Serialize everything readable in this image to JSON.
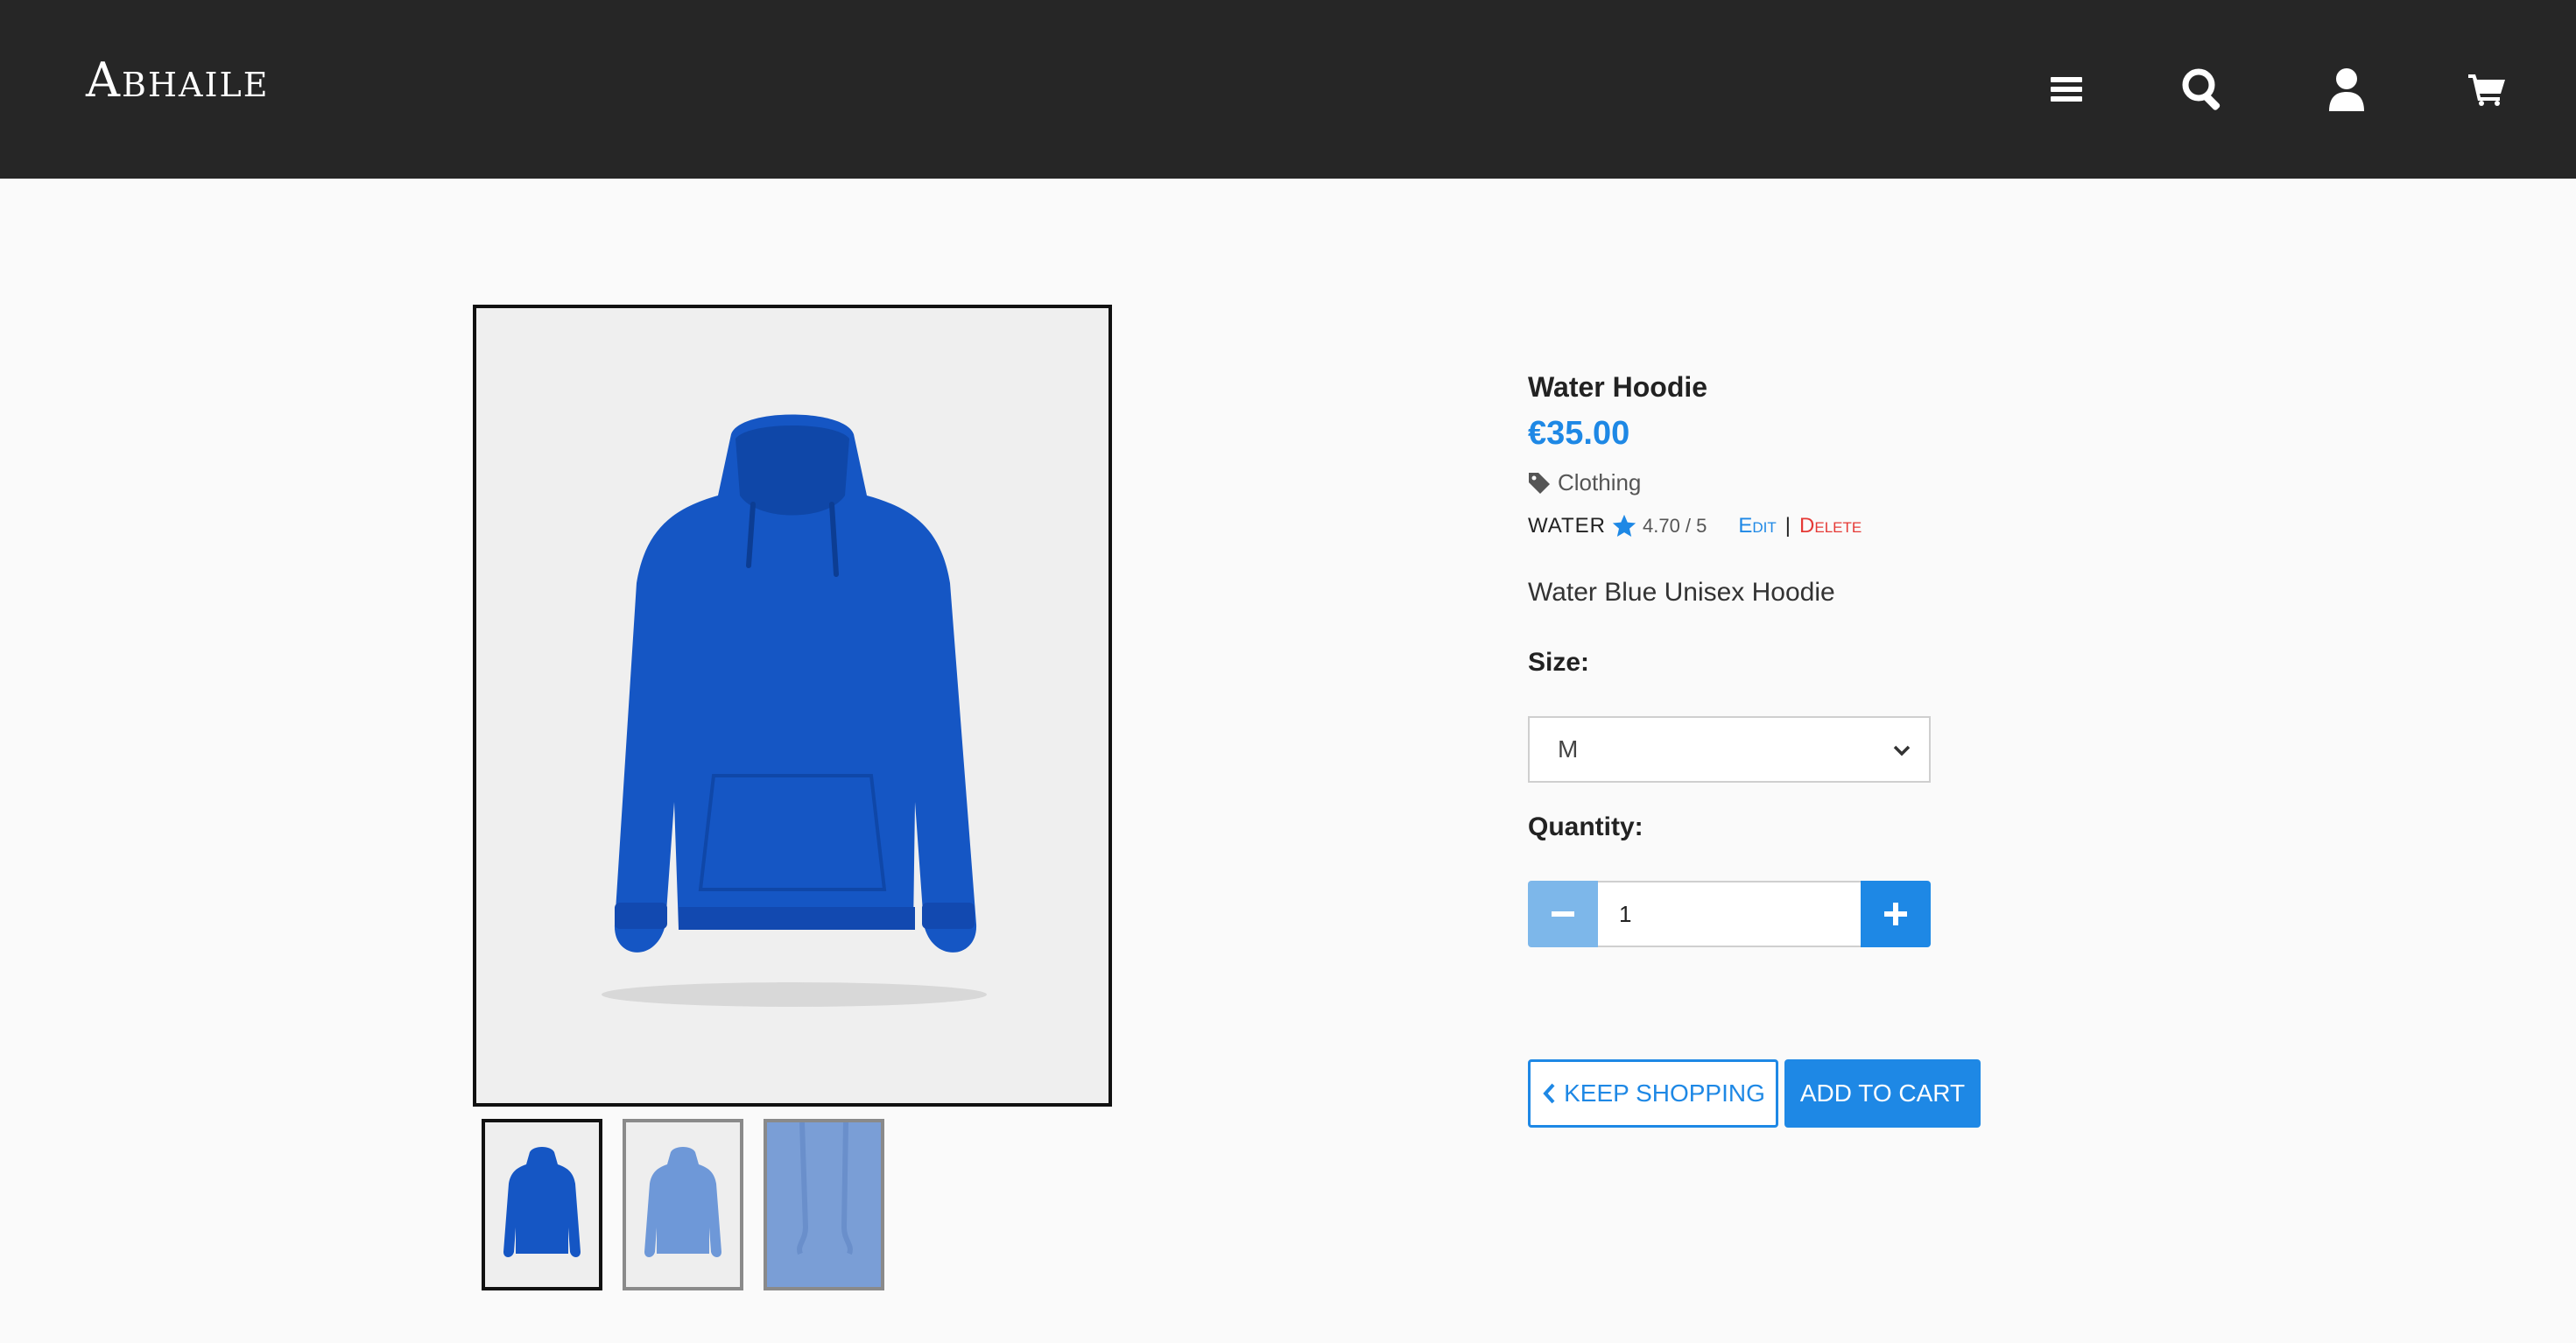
{
  "header": {
    "brand": "Abhaile",
    "icons": [
      "menu-icon",
      "search-icon",
      "user-icon",
      "cart-icon"
    ],
    "background": "#262626"
  },
  "gallery": {
    "thumbnails": [
      "hoodie-front",
      "hoodie-front-faded",
      "hoodie-detail-faded"
    ],
    "active_index": 0
  },
  "product": {
    "title": "Water Hoodie",
    "price": "€35.00",
    "category": "Clothing",
    "brand": "WATER",
    "rating": "4.70 / 5",
    "edit_label": "Edit",
    "separator": "|",
    "delete_label": "Delete",
    "description": "Water Blue Unisex Hoodie"
  },
  "form": {
    "size_label": "Size:",
    "size_value": "M",
    "quantity_label": "Quantity:",
    "quantity_value": "1",
    "keep_shopping_label": "KEEP SHOPPING",
    "add_to_cart_label": "ADD TO CART"
  },
  "colors": {
    "accent": "#1e88e5",
    "delete": "#e53935",
    "hoodie": "#1556c4"
  }
}
